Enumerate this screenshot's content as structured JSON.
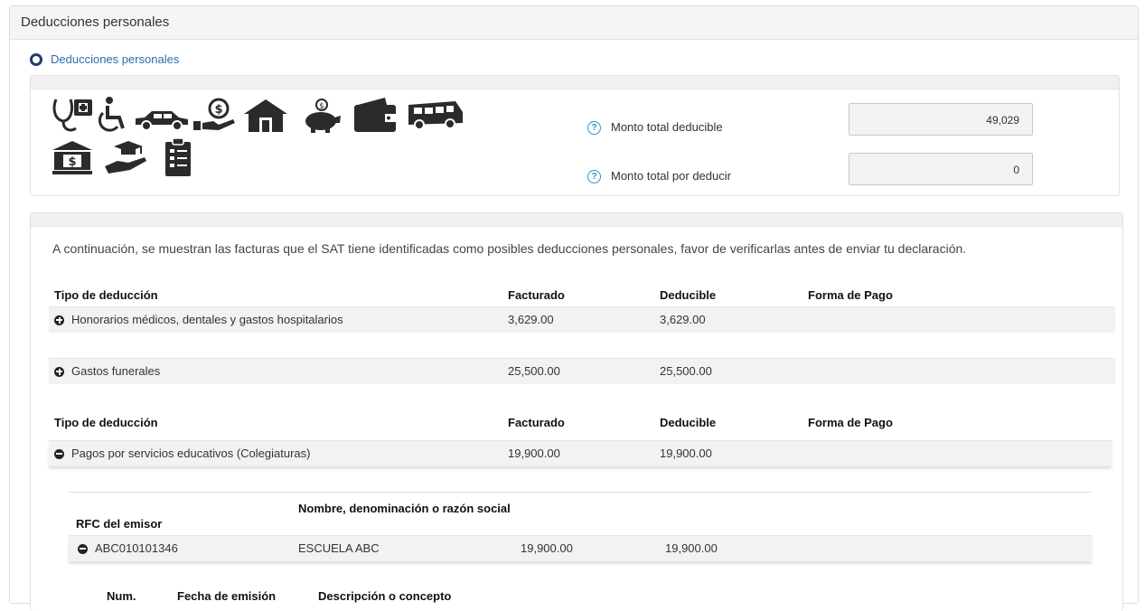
{
  "panel": {
    "title": "Deducciones personales"
  },
  "section": {
    "link_label": "Deducciones personales"
  },
  "icons": [
    "medical-icon",
    "wheelchair-icon",
    "car-icon",
    "hand-coin-icon",
    "house-icon",
    "piggy-bank-icon",
    "wallet-icon",
    "bus-icon",
    "bank-icon",
    "graduation-hand-icon",
    "clipboard-icon"
  ],
  "summary": {
    "total_deducible_label": "Monto total deducible",
    "total_deducible_value": "49,029",
    "total_por_deducir_label": "Monto total por deducir",
    "total_por_deducir_value": "0",
    "help_glyph": "?"
  },
  "intro": "A continuación, se muestran las facturas que el SAT tiene identificadas como posibles deducciones personales, favor de verificarlas antes de enviar tu declaración.",
  "table1": {
    "headers": [
      "Tipo de deducción",
      "Facturado",
      "Deducible",
      "Forma de Pago"
    ],
    "rows": [
      {
        "tipo": "Honorarios médicos, dentales y gastos hospitalarios",
        "facturado": "3,629.00",
        "deducible": "3,629.00",
        "forma": ""
      },
      {
        "tipo": "Gastos funerales",
        "facturado": "25,500.00",
        "deducible": "25,500.00",
        "forma": ""
      }
    ]
  },
  "table2": {
    "headers": [
      "Tipo de deducción",
      "Facturado",
      "Deducible",
      "Forma de Pago"
    ],
    "rows": [
      {
        "tipo": "Pagos por servicios educativos (Colegiaturas)",
        "facturado": "19,900.00",
        "deducible": "19,900.00",
        "forma": ""
      }
    ]
  },
  "emisor_table": {
    "headers": [
      "RFC del emisor",
      "Nombre, denominación o razón social"
    ],
    "rows": [
      {
        "rfc": "ABC010101346",
        "nombre": "ESCUELA ABC",
        "facturado": "19,900.00",
        "deducible": "19,900.00"
      }
    ]
  },
  "concept_table": {
    "headers": [
      "Num.",
      "Fecha de emisión",
      "Descripción o concepto"
    ]
  },
  "colors": {
    "link": "#2a6ea8",
    "help": "#2b8fc6",
    "row_bg": "#f2f2f2",
    "icon": "#2b2b2b"
  }
}
